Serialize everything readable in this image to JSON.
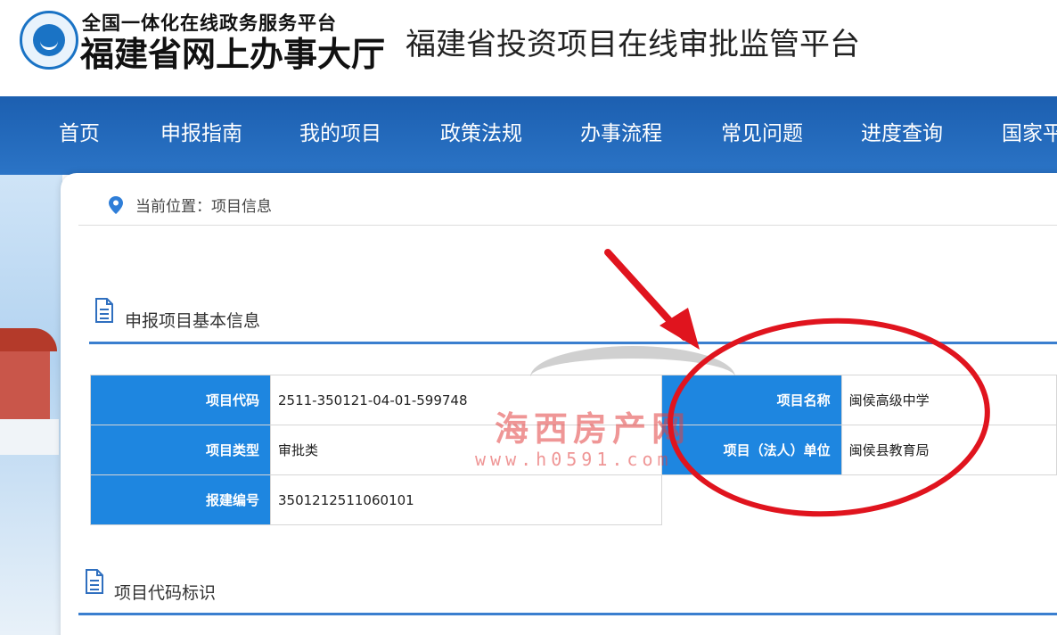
{
  "header": {
    "logo_line1": "全国一体化在线政务服务平台",
    "logo_line2": "福建省网上办事大厅",
    "platform_title": "福建省投资项目在线审批监管平台"
  },
  "nav": {
    "items": [
      "首页",
      "申报指南",
      "我的项目",
      "政策法规",
      "办事流程",
      "常见问题",
      "进度查询",
      "国家平"
    ]
  },
  "breadcrumb": {
    "text": "当前位置：项目信息"
  },
  "sections": {
    "basic_info_title": "申报项目基本信息",
    "code_id_title": "项目代码标识"
  },
  "basic_info": {
    "left": [
      {
        "label": "项目代码",
        "value": "2511-350121-04-01-599748"
      },
      {
        "label": "项目类型",
        "value": "审批类"
      },
      {
        "label": "报建编号",
        "value": "3501212511060101"
      }
    ],
    "right": [
      {
        "label": "项目名称",
        "value": "闽侯高级中学"
      },
      {
        "label": "项目（法人）单位",
        "value": "闽侯县教育局"
      }
    ]
  },
  "watermark": {
    "main": "海西房产网",
    "sub": "www.h0591.com"
  },
  "colors": {
    "nav_bg": "#2b74c6",
    "label_bg": "#1e86e0",
    "section_rule": "#3a7fcf",
    "annotation_red": "#e0141e"
  },
  "icons": [
    "location-pin-icon",
    "document-icon",
    "red-arrow-annotation",
    "red-circle-annotation"
  ]
}
